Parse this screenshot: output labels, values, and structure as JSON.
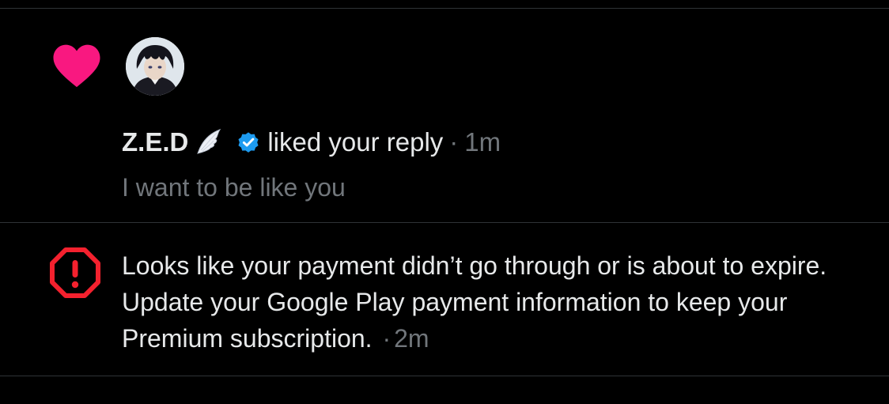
{
  "like_notification": {
    "user_name": "Z.E.D",
    "action": "liked your reply",
    "separator": "·",
    "time": "1m",
    "reply_text": "I want to be like you",
    "icon": "heart-icon",
    "accent_color": "#f91880",
    "verified_color": "#1d9bf0"
  },
  "payment_notification": {
    "message": "Looks like your payment didn’t go through or is about to expire. Update your Google Play payment information to keep your Premium subscription.",
    "separator": "·",
    "time": "2m",
    "icon": "alert-octagon-icon",
    "alert_color": "#f4212e"
  }
}
